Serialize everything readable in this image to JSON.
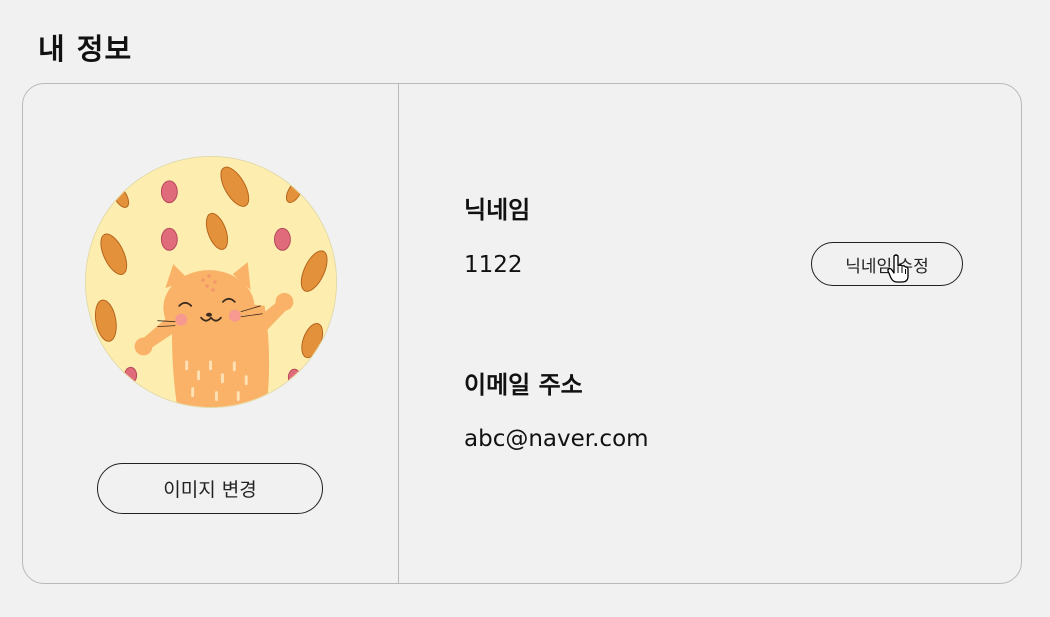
{
  "page": {
    "title": "내 정보"
  },
  "profile": {
    "avatar_icon": "cat-illustration-avatar",
    "change_image_label": "이미지 변경"
  },
  "nickname": {
    "label": "닉네임",
    "value": "1122",
    "edit_label": "닉네임 수정"
  },
  "email": {
    "label": "이메일 주소",
    "value": "abc@naver.com"
  },
  "colors": {
    "background": "#f1f1f1",
    "border": "#b9b9b9",
    "avatar_bg": "#fdeeb0",
    "cat": "#f9b268",
    "leaf_orange": "#e3913a",
    "leaf_pink": "#e06b7a"
  }
}
